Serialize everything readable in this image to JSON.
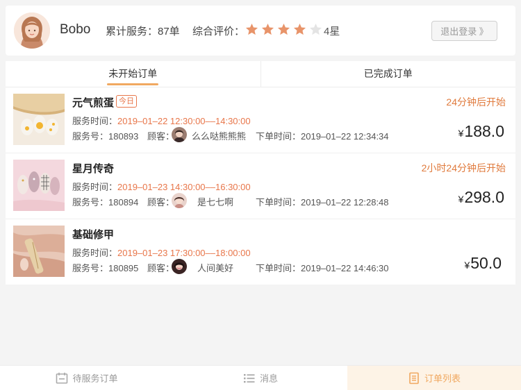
{
  "header": {
    "username": "Bobo",
    "total_service_label": "累计服务：87单",
    "rating_label": "综合评价：",
    "stars_filled": 4,
    "stars_total": 5,
    "star_text": "4星",
    "logout_label": "退出登录 》"
  },
  "tabs": [
    {
      "label": "未开始订单",
      "active": true
    },
    {
      "label": "已完成订单",
      "active": false
    }
  ],
  "orders": [
    {
      "title": "元气煎蛋",
      "badge": "今日",
      "countdown": "24分钟后开始",
      "service_time_label": "服务时间：",
      "service_time": "2019–01–22 12:30:00––14:30:00",
      "service_no": "服务号：180893",
      "customer_label": "顾客：",
      "customer": "么么哒熊熊熊",
      "order_time": "下单时间：2019–01–22 12:34:34",
      "currency": "¥",
      "price": "188.0"
    },
    {
      "title": "星月传奇",
      "badge": "",
      "countdown": "2小时24分钟后开始",
      "service_time_label": "服务时间：",
      "service_time": "2019–01–23 14:30:00––16:30:00",
      "service_no": "服务号：180894",
      "customer_label": "顾客：",
      "customer": "是七七啊",
      "order_time": "下单时间：2019–01–22 12:28:48",
      "currency": "¥",
      "price": "298.0"
    },
    {
      "title": "基础修甲",
      "badge": "",
      "countdown": "",
      "service_time_label": "服务时间：",
      "service_time": "2019–01–23 17:30:00––18:00:00",
      "service_no": "服务号：180895",
      "customer_label": "顾客：",
      "customer": "人间美好",
      "order_time": "下单时间：2019–01–22 14:46:30",
      "currency": "¥",
      "price": "50.0"
    }
  ],
  "bottom_nav": [
    {
      "label": "待服务订单",
      "icon": "calendar-icon",
      "active": false
    },
    {
      "label": "消息",
      "icon": "list-icon",
      "active": false
    },
    {
      "label": "订单列表",
      "icon": "document-icon",
      "active": true
    }
  ],
  "colors": {
    "accent": "#f0a860",
    "star": "#e8946a",
    "star_empty": "#e4e4e4",
    "highlight": "#e8764a"
  }
}
